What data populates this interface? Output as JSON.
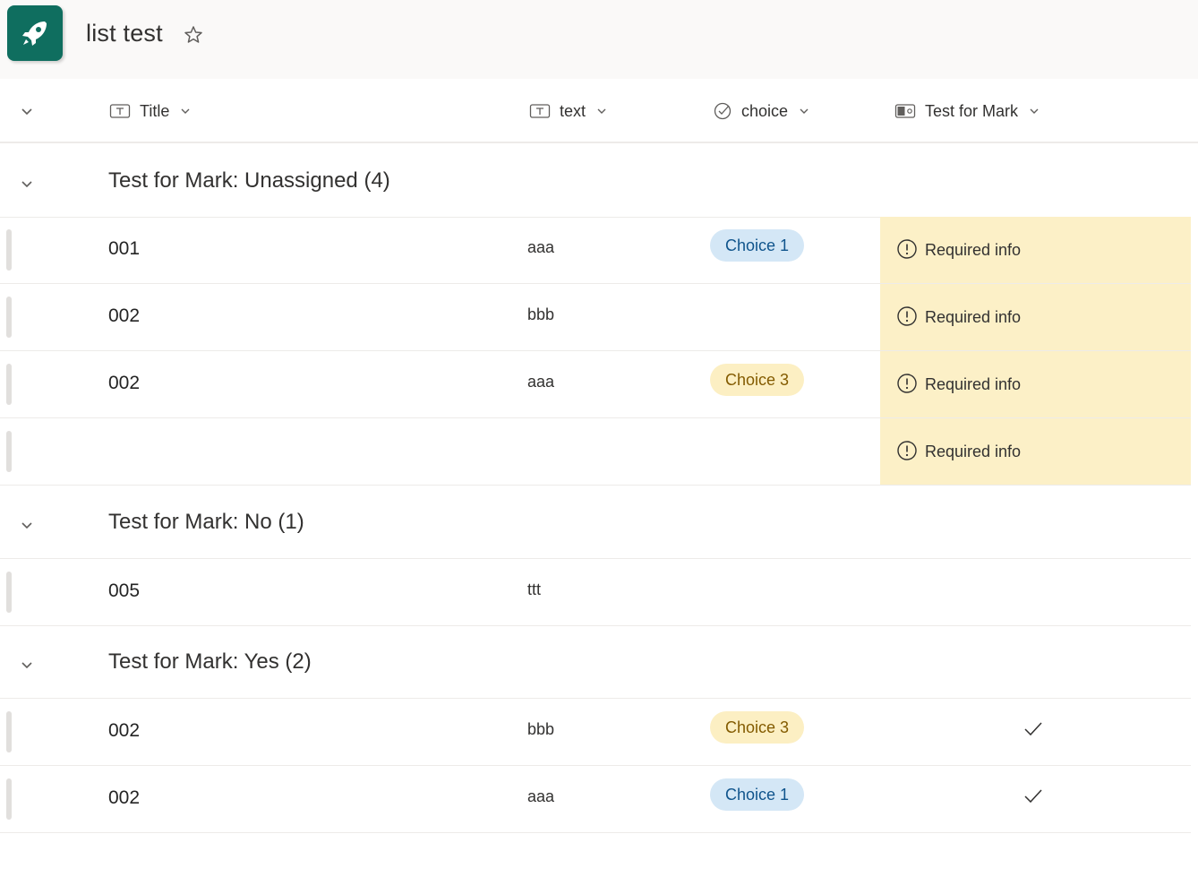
{
  "header": {
    "list_title": "list test",
    "favorite_icon": "star-outline-icon"
  },
  "columns": [
    {
      "label": "Title",
      "icon": "text-column-icon"
    },
    {
      "label": "text",
      "icon": "text-column-icon"
    },
    {
      "label": "choice",
      "icon": "choice-column-icon"
    },
    {
      "label": "Test for Mark",
      "icon": "yes-no-column-icon"
    }
  ],
  "colors": {
    "app_icon_bg": "#0f6e5f",
    "choice_1_bg": "#d4e7f6",
    "choice_1_text": "#0f548c",
    "choice_3_bg": "#fcefc3",
    "choice_3_text": "#835b00",
    "required_bg": "#fcf0c7"
  },
  "groups": [
    {
      "label": "Test for Mark: Unassigned (4)",
      "rows": [
        {
          "title": "001",
          "text": "aaa",
          "choice": "Choice 1",
          "mark": "Required info"
        },
        {
          "title": "002",
          "text": "bbb",
          "choice": "",
          "mark": "Required info"
        },
        {
          "title": "002",
          "text": "aaa",
          "choice": "Choice 3",
          "mark": "Required info"
        },
        {
          "title": "",
          "text": "",
          "choice": "",
          "mark": "Required info"
        }
      ]
    },
    {
      "label": "Test for Mark: No (1)",
      "rows": [
        {
          "title": "005",
          "text": "ttt",
          "choice": "",
          "mark": ""
        }
      ]
    },
    {
      "label": "Test for Mark: Yes (2)",
      "rows": [
        {
          "title": "002",
          "text": "bbb",
          "choice": "Choice 3",
          "mark": "checkmark"
        },
        {
          "title": "002",
          "text": "aaa",
          "choice": "Choice 1",
          "mark": "checkmark"
        }
      ]
    }
  ]
}
